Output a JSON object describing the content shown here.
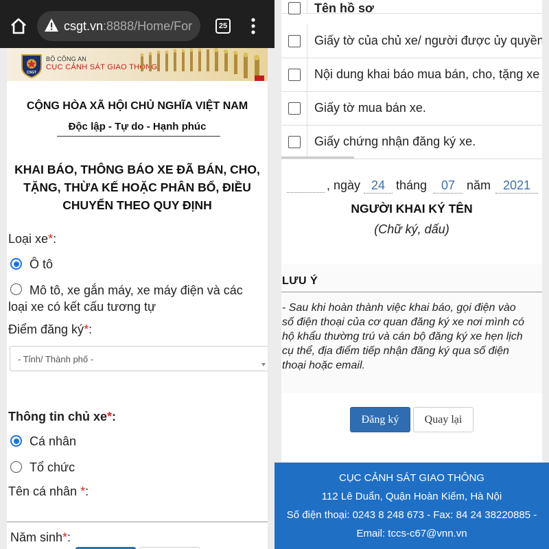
{
  "browser": {
    "url_host": "csgt.vn",
    "url_rest": ":8888/Home/For",
    "tab_count": "25"
  },
  "banner": {
    "ministry": "BỘ CÔNG AN",
    "department": "CỤC CẢNH SÁT GIAO THÔNG",
    "logo_text": "CSGT"
  },
  "header": {
    "nation": "CỘNG HÒA XÃ HỘI CHỦ NGHĨA VIỆT NAM",
    "motto": "Độc lập - Tự do - Hạnh phúc",
    "title_line1": "KHAI BÁO, THÔNG BÁO XE ĐÃ BÁN, CHO,",
    "title_line2": "TẶNG, THỪA KẾ HOẶC PHÂN BỔ, ĐIỀU",
    "title_line3": "CHUYỂN THEO QUY ĐỊNH"
  },
  "form": {
    "vehicle_type_label": "Loại xe",
    "required_mark": "*",
    "colon": ":",
    "vehicle_options": [
      {
        "label": "Ô tô",
        "selected": true
      },
      {
        "label_line1": "Mô tô, xe gắn máy, xe máy điện và các",
        "label_line2": "loại xe có kết cấu tương tự",
        "selected": false
      }
    ],
    "registration_point_label": "Điểm đăng ký",
    "province_placeholder": "- Tỉnh/ Thành phố -",
    "owner_info_label": "Thông tin chủ xe",
    "owner_options": [
      {
        "label": "Cá nhân",
        "selected": true
      },
      {
        "label": "Tổ chức",
        "selected": false
      }
    ],
    "owner_name_label": "Tên cá nhân",
    "birth_year_label": "Năm sinh"
  },
  "documents": {
    "header": "Tên hồ sơ",
    "rows": [
      "Giấy tờ của chủ xe/ người được ủy quyền",
      "Nội dung khai báo mua bán, cho, tặng xe",
      "Giấy tờ mua bán xe.",
      "Giấy chứng nhận đăng ký xe."
    ]
  },
  "signature": {
    "date_prefix": ", ngày",
    "day": "24",
    "month_word": "tháng",
    "month": "07",
    "year_word": "năm",
    "year": "2021",
    "signer": "NGƯỜI KHAI KÝ TÊN",
    "sign_note": "(Chữ ký, dấu)"
  },
  "note": {
    "title": "LƯU Ý",
    "lines": [
      "- Sau khi hoàn thành việc khai báo, gọi điện vào",
      "số điện thoại của cơ quan đăng ký xe nơi mình có",
      "hộ khẩu thường trú và cán bộ đăng ký xe hẹn lịch",
      "cụ thể, địa điểm tiếp nhận đăng ký qua số điện",
      "thoại hoặc email."
    ]
  },
  "buttons": {
    "register": "Đăng ký",
    "back": "Quay lại"
  },
  "footer": {
    "org": "CỤC CẢNH SÁT GIAO THÔNG",
    "address": "112 Lê Duẩn, Quận Hoàn Kiếm, Hà Nội",
    "phone": "Số điện thoại: 0243 8 248 673 - Fax: 84 24 38220885 -",
    "email": "Email: tccs-c67@vnn.vn"
  },
  "colors": {
    "accent_blue": "#2f6db2",
    "footer_blue": "#1f6fc5",
    "required_red": "#d9261c",
    "radio_blue": "#1a73e8"
  }
}
